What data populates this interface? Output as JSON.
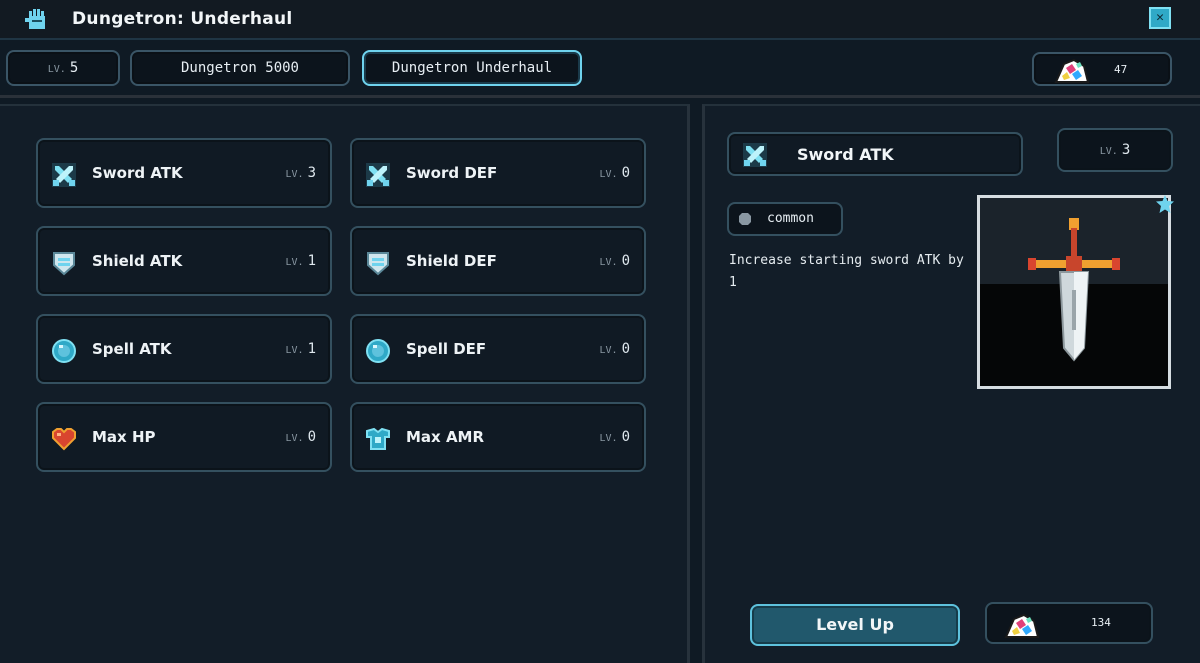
{
  "window": {
    "title": "Dungetron: Underhaul",
    "close_icon": "close-icon"
  },
  "topbar": {
    "level_prefix": "LV.",
    "level_value": "5",
    "tabs": [
      {
        "label": "Dungetron 5000",
        "active": false
      },
      {
        "label": "Dungetron Underhaul",
        "active": true
      }
    ],
    "currency_value": "47",
    "currency_icon": "gem-pile-icon"
  },
  "upgrades": [
    {
      "name": "Sword ATK",
      "lv_prefix": "LV.",
      "level": "3",
      "icon": "sword-icon"
    },
    {
      "name": "Sword DEF",
      "lv_prefix": "LV.",
      "level": "0",
      "icon": "sword-icon"
    },
    {
      "name": "Shield ATK",
      "lv_prefix": "LV.",
      "level": "1",
      "icon": "shield-icon"
    },
    {
      "name": "Shield DEF",
      "lv_prefix": "LV.",
      "level": "0",
      "icon": "shield-icon"
    },
    {
      "name": "Spell ATK",
      "lv_prefix": "LV.",
      "level": "1",
      "icon": "orb-icon"
    },
    {
      "name": "Spell DEF",
      "lv_prefix": "LV.",
      "level": "0",
      "icon": "orb-icon"
    },
    {
      "name": "Max HP",
      "lv_prefix": "LV.",
      "level": "0",
      "icon": "heart-icon"
    },
    {
      "name": "Max AMR",
      "lv_prefix": "LV.",
      "level": "0",
      "icon": "armor-icon"
    }
  ],
  "detail": {
    "name": "Sword ATK",
    "lv_prefix": "LV.",
    "level": "3",
    "rarity": "common",
    "description": "Increase starting sword ATK by 1",
    "level_up_label": "Level Up",
    "cost": "134"
  },
  "colors": {
    "accent": "#6fd3ee",
    "panel": "#121d28",
    "border": "#34505f"
  }
}
